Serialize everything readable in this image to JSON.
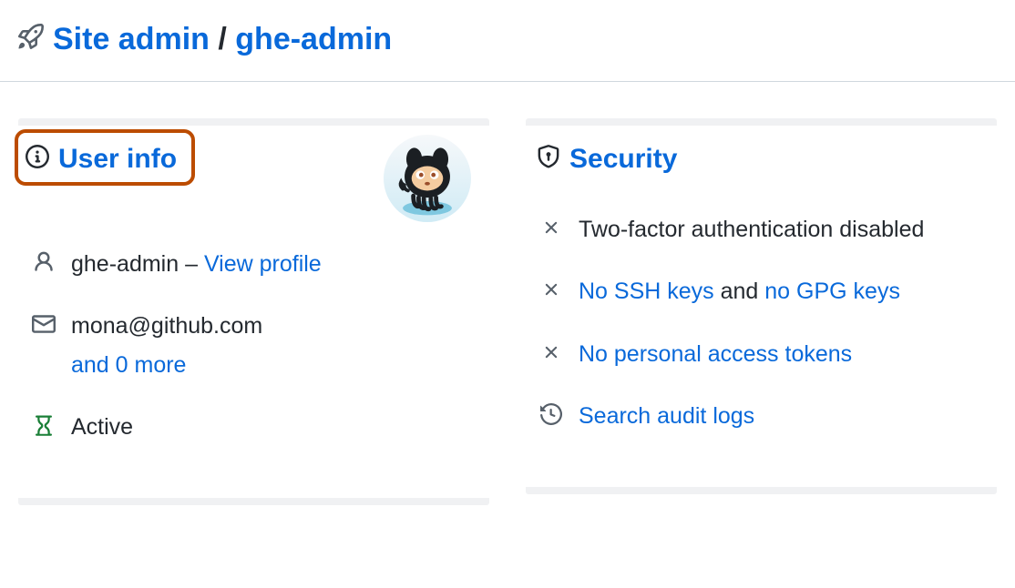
{
  "breadcrumb": {
    "site_admin": "Site admin",
    "separator": " / ",
    "username": "ghe-admin"
  },
  "user_info": {
    "title": "User info",
    "username": "ghe-admin",
    "separator": " – ",
    "view_profile_label": "View profile",
    "email": "mona@github.com",
    "email_more_label": "and 0 more",
    "status": "Active"
  },
  "security": {
    "title": "Security",
    "twofa_text": "Two-factor authentication disabled",
    "no_ssh_keys_label": "No SSH keys",
    "keys_connector": " and ",
    "no_gpg_keys_label": "no GPG keys",
    "no_tokens_label": "No personal access tokens",
    "audit_logs_label": "Search audit logs"
  }
}
